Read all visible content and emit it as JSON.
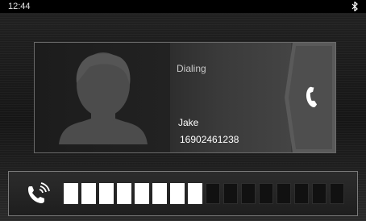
{
  "status_bar": {
    "time": "12:44",
    "bluetooth_icon": "bluetooth-icon"
  },
  "call": {
    "status": "Dialing",
    "contact_name": "Jake",
    "contact_number": "16902461238",
    "avatar_icon": "person-silhouette-icon",
    "end_call_icon": "phone-handset-icon"
  },
  "volume": {
    "icon": "speaker-volume-icon",
    "level": 8,
    "max": 16
  },
  "colors": {
    "segment_on": "#ffffff",
    "segment_off": "#111111"
  }
}
